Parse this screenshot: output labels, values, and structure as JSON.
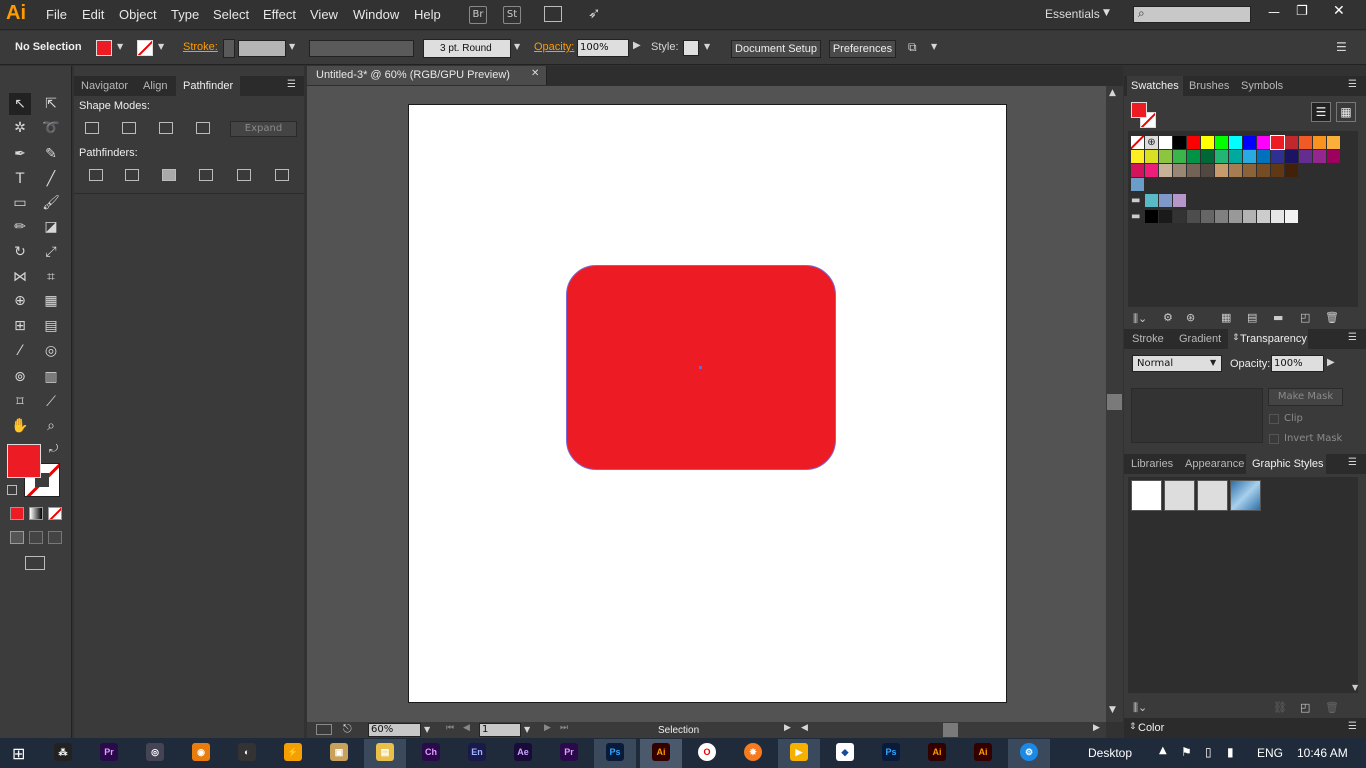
{
  "app": {
    "logo": "Ai",
    "menu": [
      "File",
      "Edit",
      "Object",
      "Type",
      "Select",
      "Effect",
      "View",
      "Window",
      "Help"
    ],
    "bridge_buttons": [
      "Br",
      "St"
    ],
    "workspace": "Essentials",
    "window_controls": [
      "—",
      "❐",
      "✕"
    ]
  },
  "control_bar": {
    "selection": "No Selection",
    "stroke_label": "Stroke:",
    "brush": "3 pt. Round",
    "opacity_label": "Opacity:",
    "opacity_value": "100%",
    "style_label": "Style:",
    "document_setup": "Document Setup",
    "preferences": "Preferences"
  },
  "left_panel": {
    "tabs": [
      "Navigator",
      "Align",
      "Pathfinder"
    ],
    "shape_modes": "Shape Modes:",
    "expand": "Expand",
    "pathfinders": "Pathfinders:"
  },
  "document": {
    "tab_title": "Untitled-3* @ 60% (RGB/GPU Preview)",
    "tab_close": "✕",
    "zoom": "60%",
    "page": "1",
    "status": "Selection"
  },
  "right_panels": {
    "swatches_tabs": [
      "Swatches",
      "Brushes",
      "Symbols"
    ],
    "transparency_tabs": [
      "Stroke",
      "Gradient",
      "Transparency"
    ],
    "blend_mode": "Normal",
    "opacity_label": "Opacity:",
    "opacity_value": "100%",
    "make_mask": "Make Mask",
    "clip": "Clip",
    "invert_mask": "Invert Mask",
    "styles_tabs": [
      "Libraries",
      "Appearance",
      "Graphic Styles"
    ],
    "color_tab": "Color"
  },
  "colors": {
    "fill": "#ed1c24",
    "accent": "#ff9a00",
    "swatch_row1": [
      "#ffffff",
      "#000000",
      "#ff0000",
      "#ffff00",
      "#00ff00",
      "#00ffff",
      "#0000ff",
      "#ff00ff",
      "#ed1c24",
      "#c1272d",
      "#f15a24",
      "#f7931e",
      "#fbb03b"
    ],
    "swatch_row2": [
      "#fcee21",
      "#d9e021",
      "#8cc63f",
      "#39b54a",
      "#009245",
      "#006837",
      "#22b573",
      "#00a99d",
      "#29abe2",
      "#0071bc",
      "#2e3192",
      "#1b1464",
      "#662d91",
      "#93278f",
      "#9e005d"
    ],
    "swatch_row3": [
      "#d4145a",
      "#ed1e79",
      "#c7b299",
      "#998675",
      "#736357",
      "#534741",
      "#c69c6d",
      "#a67c52",
      "#8c6239",
      "#754c24",
      "#603813",
      "#42210b"
    ],
    "swatch_cool": [
      "#59b9c6",
      "#7f97c9",
      "#b497c8"
    ],
    "swatch_grays": [
      "#000000",
      "#1a1a1a",
      "#333333",
      "#4d4d4d",
      "#666666",
      "#808080",
      "#999999",
      "#b3b3b3",
      "#cccccc",
      "#e6e6e6",
      "#f2f2f2"
    ]
  },
  "taskbar": {
    "apps": [
      "Pr",
      "Ch",
      "En",
      "Ae",
      "Pr",
      "Ps",
      "Ai",
      "Ps",
      "Ai",
      "Ai"
    ],
    "desktop": "Desktop",
    "language": "ENG",
    "time": "10:46 AM"
  }
}
